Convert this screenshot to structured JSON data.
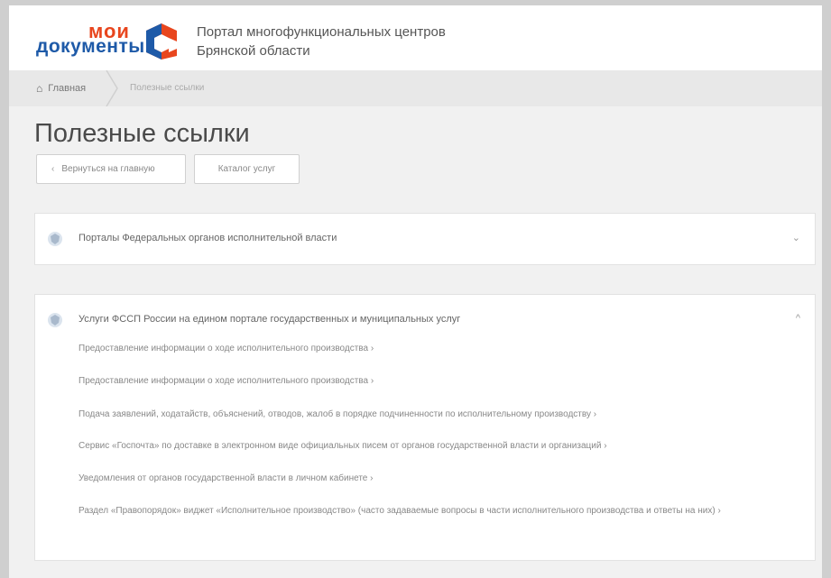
{
  "header": {
    "logo_top": "мои",
    "logo_bottom": "документы",
    "portal_line1": "Портал многофункциональных центров",
    "portal_line2": "Брянской области",
    "brand_color": "#e8461e",
    "logo_text_color": "#1e5aa8"
  },
  "breadcrumb": {
    "home_label": "Главная",
    "home_icon": "home-icon",
    "current": "Полезные ссылки"
  },
  "page": {
    "title": "Полезные ссылки",
    "back_button": "Вернуться на главную",
    "catalog_button": "Каталог услуг"
  },
  "sections": [
    {
      "title": "Порталы Федеральных органов исполнительной власти",
      "icon": "emblem-icon",
      "expanded": false,
      "chevron": "⌄"
    },
    {
      "title": "Услуги ФССП России на едином портале государственных и муниципальных услуг",
      "icon": "emblem-icon",
      "expanded": true,
      "chevron": "^",
      "links": [
        "Предоставление информации о ходе исполнительного производства ›",
        "Предоставление информации о ходе исполнительного производства ›",
        "Подача заявлений, ходатайств, объяснений, отводов, жалоб в порядке подчиненности по исполнительному производству ›",
        "Сервис «Госпочта» по доставке в электронном виде официальных писем от органов государственной власти и организаций ›",
        "Уведомления от органов государственной власти в личном кабинете ›",
        "Раздел «Правопорядок» виджет «Исполнительное производство» (часто задаваемые вопросы в части исполнительного производства и ответы на них) ›"
      ]
    }
  ]
}
